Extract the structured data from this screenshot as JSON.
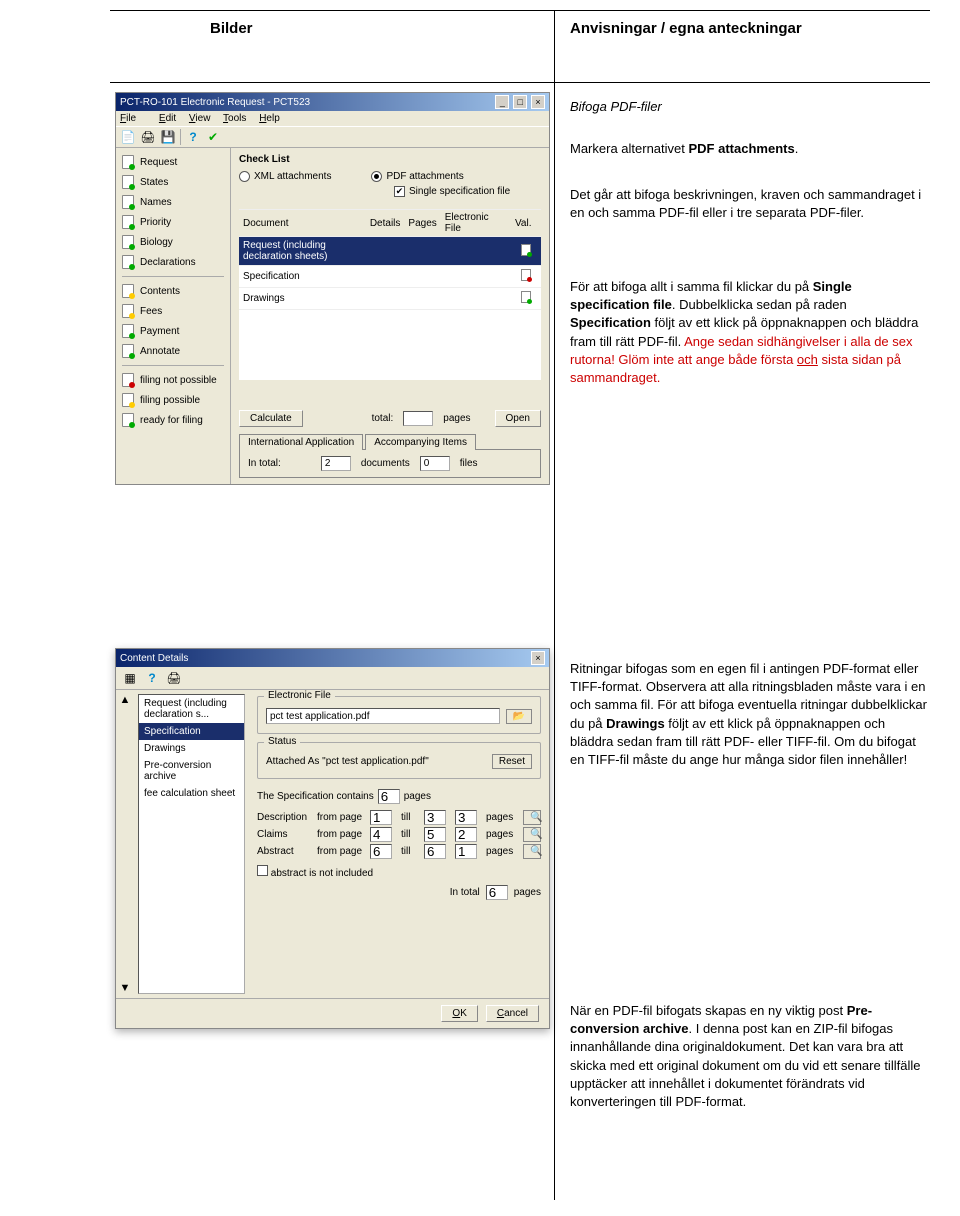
{
  "page_header": {
    "left": "Bilder",
    "right": "Anvisningar / egna anteckningar"
  },
  "instructions": {
    "heading1": "Bifoga PDF-filer",
    "p1a": "Markera alternativet ",
    "p1b": "PDF attachments",
    "p1c": ".",
    "p2": "Det går att bifoga beskrivningen, kraven och sammandraget i en och samma PDF-fil eller i tre separata PDF-filer.",
    "p3a": "För att bifoga allt i samma fil klickar du på ",
    "p3b": "Single specification file",
    "p3c": ". Dubbelklicka sedan på raden ",
    "p3d": "Specification",
    "p3e": " följt av ett klick på öppnaknappen och bläddra fram till rätt PDF-fil. ",
    "p3f": "Ange sedan sidhängivelser i alla de sex rutorna! Glöm inte att ange både första ",
    "p3f_u": "och",
    "p3f2": " sista sidan på sammandraget.",
    "p4a": "Ritningar bifogas som en egen fil i antingen PDF-format eller TIFF-format. Observera att alla ritningsbladen måste vara i en och samma fil. För att bifoga eventuella ritningar dubbelklickar du på ",
    "p4b": "Drawings",
    "p4c": " följt av ett klick på öppnaknappen och bläddra sedan fram till rätt PDF- eller TIFF-fil. Om du bifogat en TIFF-fil måste du ange hur många sidor filen innehåller!",
    "p5a": "När en PDF-fil bifogats skapas en ny viktig post ",
    "p5b": "Pre-conversion archive",
    "p5c": ". I denna post kan en ZIP-fil bifogas innanhållande dina originaldokument. Det kan vara bra att skicka med ett original dokument om du vid ett senare tillfälle upptäcker att innehållet i dokumentet förändrats vid konverteringen till PDF-format."
  },
  "win1": {
    "title": "PCT-RO-101 Electronic Request - PCT523",
    "menus": [
      "File",
      "Edit",
      "View",
      "Tools",
      "Help"
    ],
    "sidebar_top": [
      {
        "label": "Request",
        "color": "green"
      },
      {
        "label": "States",
        "color": "green"
      },
      {
        "label": "Names",
        "color": "green"
      },
      {
        "label": "Priority",
        "color": "green"
      },
      {
        "label": "Biology",
        "color": "green"
      },
      {
        "label": "Declarations",
        "color": "green"
      }
    ],
    "sidebar_mid": [
      {
        "label": "Contents",
        "color": "yellow"
      },
      {
        "label": "Fees",
        "color": "yellow"
      },
      {
        "label": "Payment",
        "color": "green"
      },
      {
        "label": "Annotate",
        "color": "green"
      }
    ],
    "sidebar_bot": [
      {
        "label": "filing not possible",
        "color": "red"
      },
      {
        "label": "filing possible",
        "color": "yellow"
      },
      {
        "label": "ready for filing",
        "color": "green"
      }
    ],
    "checklist_label": "Check List",
    "xml_label": "XML attachments",
    "pdf_label": "PDF attachments",
    "singlefile_label": "Single specification file",
    "columns": {
      "doc": "Document",
      "details": "Details",
      "pages": "Pages",
      "ef": "Electronic File",
      "val": "Val."
    },
    "rows": [
      {
        "doc": "Request (including declaration sheets)",
        "val": "green",
        "sel": true
      },
      {
        "doc": "Specification",
        "val": "red"
      },
      {
        "doc": "Drawings",
        "val": "green"
      }
    ],
    "calculate_btn": "Calculate",
    "total_lbl": "total:",
    "pages_lbl": "pages",
    "open_btn": "Open",
    "tab_intl": "International Application",
    "tab_acc": "Accompanying Items",
    "intotal": "In total:",
    "doc_count": "2",
    "docs_lbl": "documents",
    "file_count": "0",
    "files_lbl": "files"
  },
  "win2": {
    "title": "Content Details",
    "left_items": [
      "Request (including declaration s...",
      "Specification",
      "Drawings",
      "Pre-conversion archive",
      "fee calculation sheet"
    ],
    "sel_index": 1,
    "ef_grp": "Electronic File",
    "file_name": "pct test application.pdf",
    "status_grp": "Status",
    "status_text": "Attached As \"pct test application.pdf\"",
    "reset_btn": "Reset",
    "spec_contains": "The Specification contains",
    "spec_pages": "6",
    "pages": "pages",
    "rows": [
      {
        "label": "Description",
        "from": "from page",
        "v1": "1",
        "till": "till",
        "v2": "3",
        "cnt": "3",
        "suffix": "pages"
      },
      {
        "label": "Claims",
        "from": "from page",
        "v1": "4",
        "till": "till",
        "v2": "5",
        "cnt": "2",
        "suffix": "pages"
      },
      {
        "label": "Abstract",
        "from": "from page",
        "v1": "6",
        "till": "till",
        "v2": "6",
        "cnt": "1",
        "suffix": "pages"
      }
    ],
    "abstract_cb": "abstract is not included",
    "intotal": "In total",
    "intotal_val": "6",
    "intotal_suffix": "pages",
    "ok": "OK",
    "cancel": "Cancel"
  }
}
